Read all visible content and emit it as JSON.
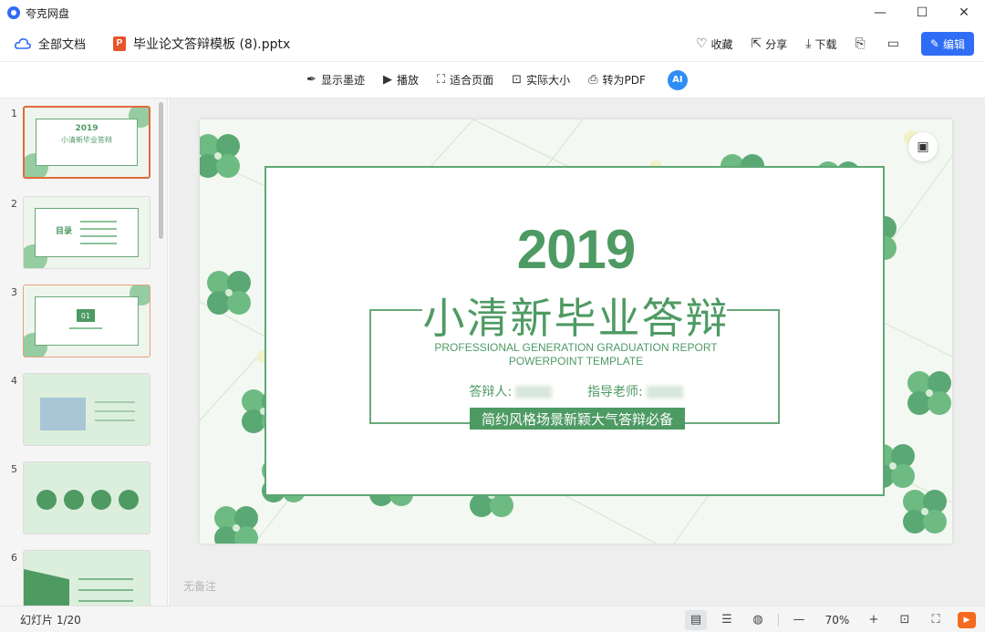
{
  "app": {
    "name": "夸克网盘"
  },
  "window_controls": {
    "minimize": "—",
    "maximize": "☐",
    "close": "✕"
  },
  "header": {
    "all_docs": "全部文档",
    "file_name": "毕业论文答辩模板 (8).pptx",
    "actions": {
      "favorite": "收藏",
      "share": "分享",
      "download": "下载",
      "edit": "编辑"
    }
  },
  "toolbar": {
    "show_ink": "显示墨迹",
    "play": "播放",
    "fit_page": "适合页面",
    "actual_size": "实际大小",
    "to_pdf": "转为PDF"
  },
  "thumbnails": [
    {
      "num": "1",
      "title": "2019",
      "sub": "小清新毕业答辩"
    },
    {
      "num": "2",
      "title": "目录"
    },
    {
      "num": "3",
      "title": "01"
    },
    {
      "num": "4"
    },
    {
      "num": "5"
    },
    {
      "num": "6"
    }
  ],
  "slide": {
    "year": "2019",
    "title": "小清新毕业答辩",
    "en_line1": "PROFESSIONAL GENERATION GRADUATION REPORT",
    "en_line2": "POWERPOINT TEMPLATE",
    "presenter_label": "答辩人:",
    "advisor_label": "指导老师:",
    "ribbon": "简约风格场景新颖大气答辩必备"
  },
  "notes": "无备注",
  "status": {
    "slide_count": "幻灯片 1/20",
    "zoom": "70%"
  },
  "colors": {
    "accent": "#2f6df6",
    "slide_green": "#4e9a63",
    "selected_thumb": "#e06a3a"
  }
}
